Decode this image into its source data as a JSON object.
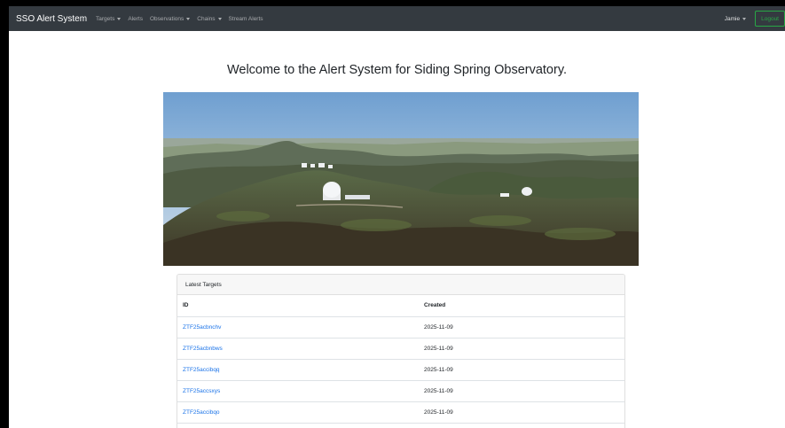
{
  "navbar": {
    "brand": "SSO Alert System",
    "items": [
      {
        "label": "Targets",
        "dropdown": true
      },
      {
        "label": "Alerts",
        "dropdown": false
      },
      {
        "label": "Observations",
        "dropdown": true
      },
      {
        "label": "Chains",
        "dropdown": true
      },
      {
        "label": "Stream Alerts",
        "dropdown": false
      }
    ],
    "user": "Jamie",
    "logout": "Logout"
  },
  "page": {
    "title": "Welcome to the Alert System for Siding Spring Observatory."
  },
  "latest_targets": {
    "header": "Latest Targets",
    "columns": [
      "ID",
      "Created"
    ],
    "rows": [
      {
        "id": "ZTF25acbnchv",
        "created": "2025-11-09"
      },
      {
        "id": "ZTF25acbnbws",
        "created": "2025-11-09"
      },
      {
        "id": "ZTF25accibqq",
        "created": "2025-11-09"
      },
      {
        "id": "ZTF25accsxys",
        "created": "2025-11-09"
      },
      {
        "id": "ZTF25accibqo",
        "created": "2025-11-09"
      }
    ]
  },
  "colors": {
    "navbar_bg": "#343a40",
    "link": "#1a73e8",
    "logout": "#28a745"
  }
}
